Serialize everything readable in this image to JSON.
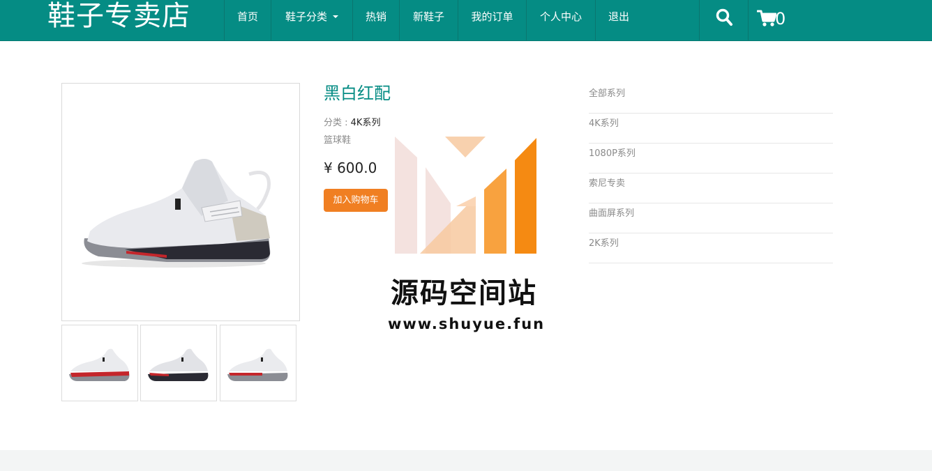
{
  "header": {
    "brand": "鞋子专卖店",
    "nav": [
      {
        "label": "首页"
      },
      {
        "label": "鞋子分类"
      },
      {
        "label": "热销"
      },
      {
        "label": "新鞋子"
      },
      {
        "label": "我的订单"
      },
      {
        "label": "个人中心"
      },
      {
        "label": "退出"
      }
    ],
    "cart_count": "0",
    "icons": [
      "search-icon",
      "cart-icon",
      "chevron-down-icon"
    ],
    "bg_color": "#058c84"
  },
  "product": {
    "title": "黑白红配",
    "category_label": "分类 : ",
    "category_value": "4K系列",
    "type": "篮球鞋",
    "price": "¥ 600.0",
    "add_to_cart": "加入购物车",
    "accent_color": "#f07f22"
  },
  "sidebar": {
    "items": [
      {
        "label": "全部系列"
      },
      {
        "label": "4K系列"
      },
      {
        "label": "1080P系列"
      },
      {
        "label": "索尼专卖"
      },
      {
        "label": "曲面屏系列"
      },
      {
        "label": "2K系列"
      }
    ]
  },
  "watermark": {
    "name": "源码空间站",
    "url": "www.shuyue.fun"
  }
}
